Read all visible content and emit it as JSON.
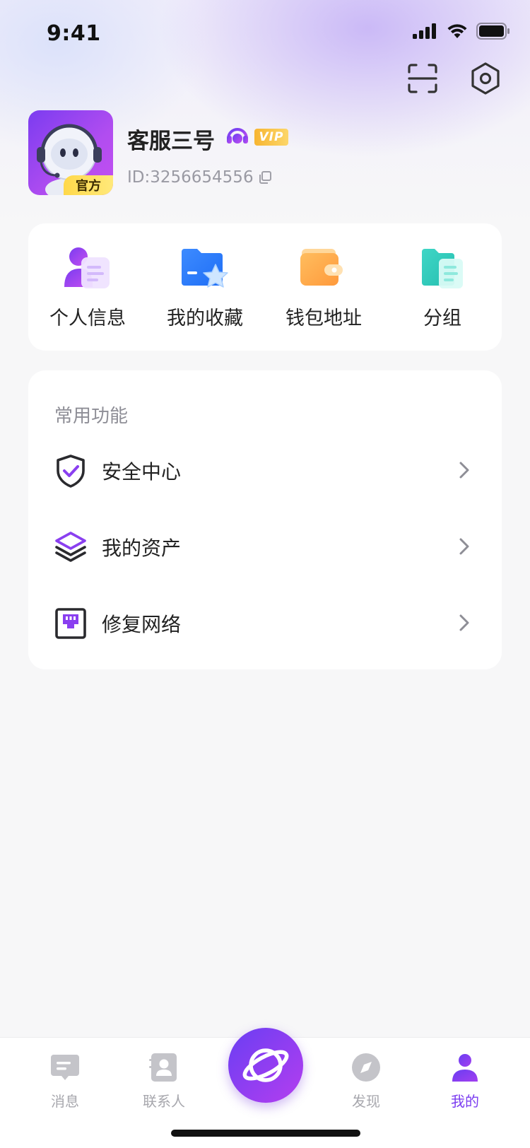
{
  "status_bar": {
    "time": "9:41"
  },
  "header": {
    "scan_icon": "scan-icon",
    "settings_icon": "hexagon-settings-icon"
  },
  "profile": {
    "name": "客服三号",
    "official_badge": "官方",
    "vip_badge": "VIP",
    "user_id": "ID:3256654556"
  },
  "quick_actions": [
    {
      "label": "个人信息",
      "icon": "personal-info-icon"
    },
    {
      "label": "我的收藏",
      "icon": "favorites-folder-icon"
    },
    {
      "label": "钱包地址",
      "icon": "wallet-icon"
    },
    {
      "label": "分组",
      "icon": "group-folder-icon"
    }
  ],
  "functions": {
    "title": "常用功能",
    "items": [
      {
        "label": "安全中心",
        "icon": "shield-check-icon"
      },
      {
        "label": "我的资产",
        "icon": "layers-icon"
      },
      {
        "label": "修复网络",
        "icon": "network-repair-icon"
      }
    ]
  },
  "tab_bar": {
    "tabs": [
      {
        "label": "消息",
        "icon": "message-icon",
        "active": false
      },
      {
        "label": "联系人",
        "icon": "contacts-icon",
        "active": false
      },
      {
        "label": "",
        "icon": "planet-icon",
        "active": false
      },
      {
        "label": "发现",
        "icon": "compass-icon",
        "active": false
      },
      {
        "label": "我的",
        "icon": "profile-icon",
        "active": true
      }
    ]
  },
  "colors": {
    "accent": "#7b3cf0",
    "vip": "#f7b531",
    "official": "#ffd84a"
  }
}
